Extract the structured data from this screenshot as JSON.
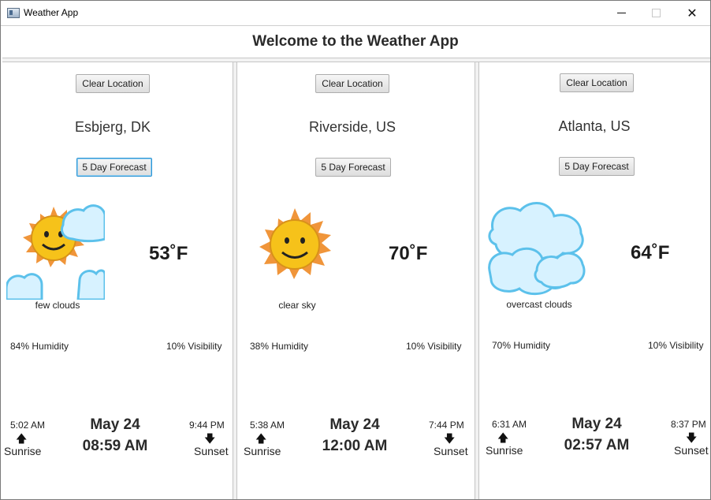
{
  "window": {
    "title": "Weather App",
    "minimize_icon": "minimize-icon",
    "maximize_icon": "maximize-icon",
    "close_icon": "close-icon",
    "close_glyph": "✕"
  },
  "header": {
    "title": "Welcome to the Weather App"
  },
  "panels": [
    {
      "clear_label": "Clear Location",
      "city": "Esbjerg, DK",
      "forecast_label": "5 Day Forecast",
      "icon": "few-clouds-icon",
      "temperature": "53˚F",
      "description": "few clouds",
      "humidity": "84% Humidity",
      "visibility": "10% Visibility",
      "sunrise_time": "5:02 AM",
      "sunrise_label": "Sunrise",
      "sunset_time": "9:44 PM",
      "sunset_label": "Sunset",
      "date": "May 24",
      "time": "08:59 AM",
      "up_arrow": "🡅",
      "down_arrow": "🡇"
    },
    {
      "clear_label": "Clear Location",
      "city": "Riverside, US",
      "forecast_label": "5 Day Forecast",
      "icon": "clear-sky-icon",
      "temperature": "70˚F",
      "description": "clear sky",
      "humidity": "38% Humidity",
      "visibility": "10% Visibility",
      "sunrise_time": "5:38 AM",
      "sunrise_label": "Sunrise",
      "sunset_time": "7:44 PM",
      "sunset_label": "Sunset",
      "date": "May 24",
      "time": "12:00 AM",
      "up_arrow": "🡅",
      "down_arrow": "🡇"
    },
    {
      "clear_label": "Clear Location",
      "city": "Atlanta, US",
      "forecast_label": "5 Day Forecast",
      "icon": "overcast-clouds-icon",
      "temperature": "64˚F",
      "description": "overcast clouds",
      "humidity": "70% Humidity",
      "visibility": "10% Visibility",
      "sunrise_time": "6:31 AM",
      "sunrise_label": "Sunrise",
      "sunset_time": "8:37 PM",
      "sunset_label": "Sunset",
      "date": "May 24",
      "time": "02:57 AM",
      "up_arrow": "🡅",
      "down_arrow": "🡇"
    }
  ],
  "colors": {
    "sun_body": "#f6c21a",
    "sun_rays": "#f0953a",
    "cloud": "#cfeeff",
    "cloud_edge": "#6cc7ef"
  }
}
